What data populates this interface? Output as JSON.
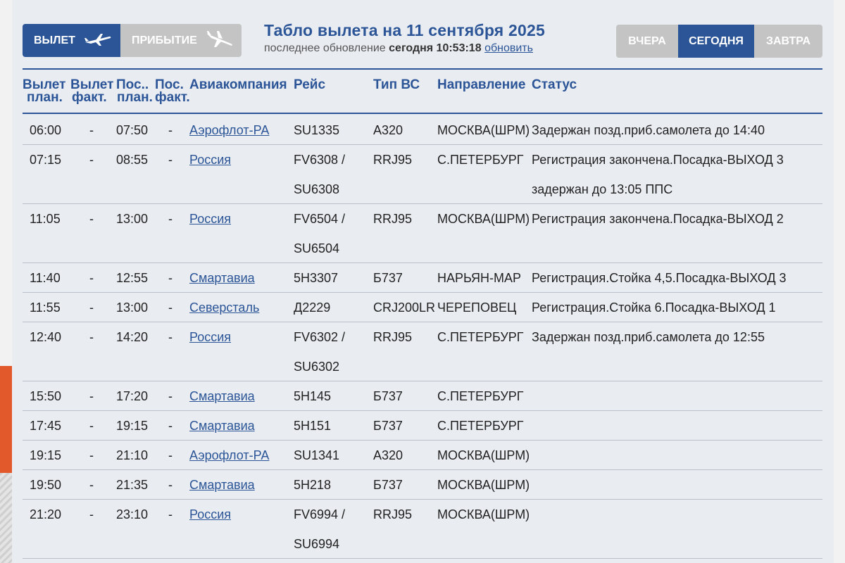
{
  "direction_tabs": {
    "departure_label": "ВЫЛЕТ",
    "arrival_label": "ПРИБЫТИЕ",
    "departure_icon": "airplane-takeoff-icon",
    "arrival_icon": "airplane-landing-icon"
  },
  "header": {
    "title": "Табло вылета на 11 сентября 2025",
    "update_prefix": "последнее обновление ",
    "update_time": "сегодня 10:53:18",
    "refresh_link": "обновить"
  },
  "day_tabs": {
    "yesterday": "ВЧЕРА",
    "today": "СЕГОДНЯ",
    "tomorrow": "ЗАВТРА",
    "selected": "СЕГОДНЯ"
  },
  "columns": {
    "dep_plan_1": "Вылет",
    "dep_plan_2": "план.",
    "dep_fact_1": "Вылет",
    "dep_fact_2": "факт.",
    "land_plan_1": "Пос..",
    "land_plan_2": "план.",
    "land_fact_1": "Пос.",
    "land_fact_2": "факт.",
    "airline": "Авиакомпания",
    "flight": "Рейс",
    "aircraft": "Тип ВС",
    "destination": "Направление",
    "status": "Статус"
  },
  "flights": [
    {
      "dep_plan": "06:00",
      "dep_fact": "-",
      "land_plan": "07:50",
      "land_fact": "-",
      "airline": "Аэрофлот-РА",
      "flight1": "SU1335",
      "flight2": "",
      "aircraft": "A320",
      "destination": "МОСКВА(ШРМ)",
      "status1": "Задержан позд.приб.самолета до 14:40",
      "status2": ""
    },
    {
      "dep_plan": "07:15",
      "dep_fact": "-",
      "land_plan": "08:55",
      "land_fact": "-",
      "airline": "Россия",
      "flight1": "FV6308 /",
      "flight2": "SU6308",
      "aircraft": "RRJ95",
      "destination": "С.ПЕТЕРБУРГ",
      "status1": "Регистрация закончена.Посадка-ВЫХОД 3",
      "status2": "задержан до 13:05 ППС"
    },
    {
      "dep_plan": "11:05",
      "dep_fact": "-",
      "land_plan": "13:00",
      "land_fact": "-",
      "airline": "Россия",
      "flight1": "FV6504 /",
      "flight2": "SU6504",
      "aircraft": "RRJ95",
      "destination": "МОСКВА(ШРМ)",
      "status1": "Регистрация закончена.Посадка-ВЫХОД 2",
      "status2": ""
    },
    {
      "dep_plan": "11:40",
      "dep_fact": "-",
      "land_plan": "12:55",
      "land_fact": "-",
      "airline": "Смартавиа",
      "flight1": "5H3307",
      "flight2": "",
      "aircraft": "Б737",
      "destination": "НАРЬЯН-МАР",
      "status1": "Регистрация.Стойка 4,5.Посадка-ВЫХОД 3",
      "status2": ""
    },
    {
      "dep_plan": "11:55",
      "dep_fact": "-",
      "land_plan": "13:00",
      "land_fact": "-",
      "airline": "Северсталь",
      "flight1": "Д2229",
      "flight2": "",
      "aircraft": "CRJ200LR",
      "destination": "ЧЕРЕПОВЕЦ",
      "status1": "Регистрация.Стойка 6.Посадка-ВЫХОД 1",
      "status2": ""
    },
    {
      "dep_plan": "12:40",
      "dep_fact": "-",
      "land_plan": "14:20",
      "land_fact": "-",
      "airline": "Россия",
      "flight1": "FV6302 /",
      "flight2": "SU6302",
      "aircraft": "RRJ95",
      "destination": "С.ПЕТЕРБУРГ",
      "status1": "Задержан позд.приб.самолета до 12:55",
      "status2": ""
    },
    {
      "dep_plan": "15:50",
      "dep_fact": "-",
      "land_plan": "17:20",
      "land_fact": "-",
      "airline": "Смартавиа",
      "flight1": "5H145",
      "flight2": "",
      "aircraft": "Б737",
      "destination": "С.ПЕТЕРБУРГ",
      "status1": "",
      "status2": ""
    },
    {
      "dep_plan": "17:45",
      "dep_fact": "-",
      "land_plan": "19:15",
      "land_fact": "-",
      "airline": "Смартавиа",
      "flight1": "5H151",
      "flight2": "",
      "aircraft": "Б737",
      "destination": "С.ПЕТЕРБУРГ",
      "status1": "",
      "status2": ""
    },
    {
      "dep_plan": "19:15",
      "dep_fact": "-",
      "land_plan": "21:10",
      "land_fact": "-",
      "airline": "Аэрофлот-РА",
      "flight1": "SU1341",
      "flight2": "",
      "aircraft": "A320",
      "destination": "МОСКВА(ШРМ)",
      "status1": "",
      "status2": ""
    },
    {
      "dep_plan": "19:50",
      "dep_fact": "-",
      "land_plan": "21:35",
      "land_fact": "-",
      "airline": "Смартавиа",
      "flight1": "5H218",
      "flight2": "",
      "aircraft": "Б737",
      "destination": "МОСКВА(ШРМ)",
      "status1": "",
      "status2": ""
    },
    {
      "dep_plan": "21:20",
      "dep_fact": "-",
      "land_plan": "23:10",
      "land_fact": "-",
      "airline": "Россия",
      "flight1": "FV6994 /",
      "flight2": "SU6994",
      "aircraft": "RRJ95",
      "destination": "МОСКВА(ШРМ)",
      "status1": "",
      "status2": ""
    }
  ],
  "colors": {
    "accent": "#2b5597",
    "inactive_tab": "#c4c4c4",
    "panel_bg": "#e9ecf1",
    "orange_deco": "#e25a2c"
  }
}
